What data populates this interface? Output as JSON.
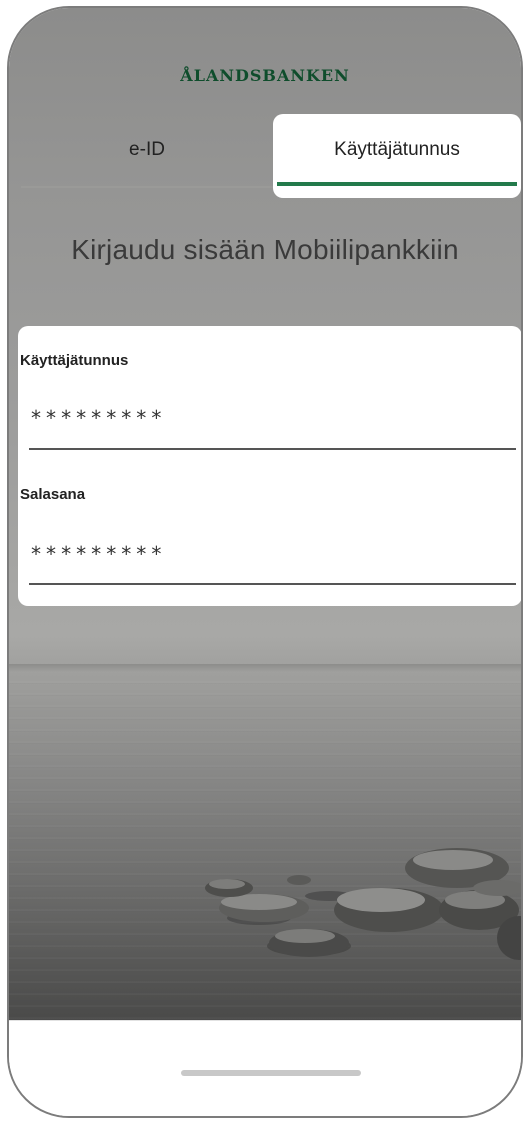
{
  "brand": {
    "name": "ÅLANDSBANKEN",
    "color": "#0f4d2c"
  },
  "tabs": [
    {
      "label": "e-ID",
      "active": false
    },
    {
      "label": "Käyttäjätunnus",
      "active": true
    }
  ],
  "accent_color": "#237a4b",
  "heading": "Kirjaudu sisään Mobiilipankkiin",
  "form": {
    "username": {
      "label": "Käyttäjätunnus",
      "value": "*********"
    },
    "password": {
      "label": "Salasana",
      "value": "*********"
    }
  },
  "background": "sea-with-rocks"
}
